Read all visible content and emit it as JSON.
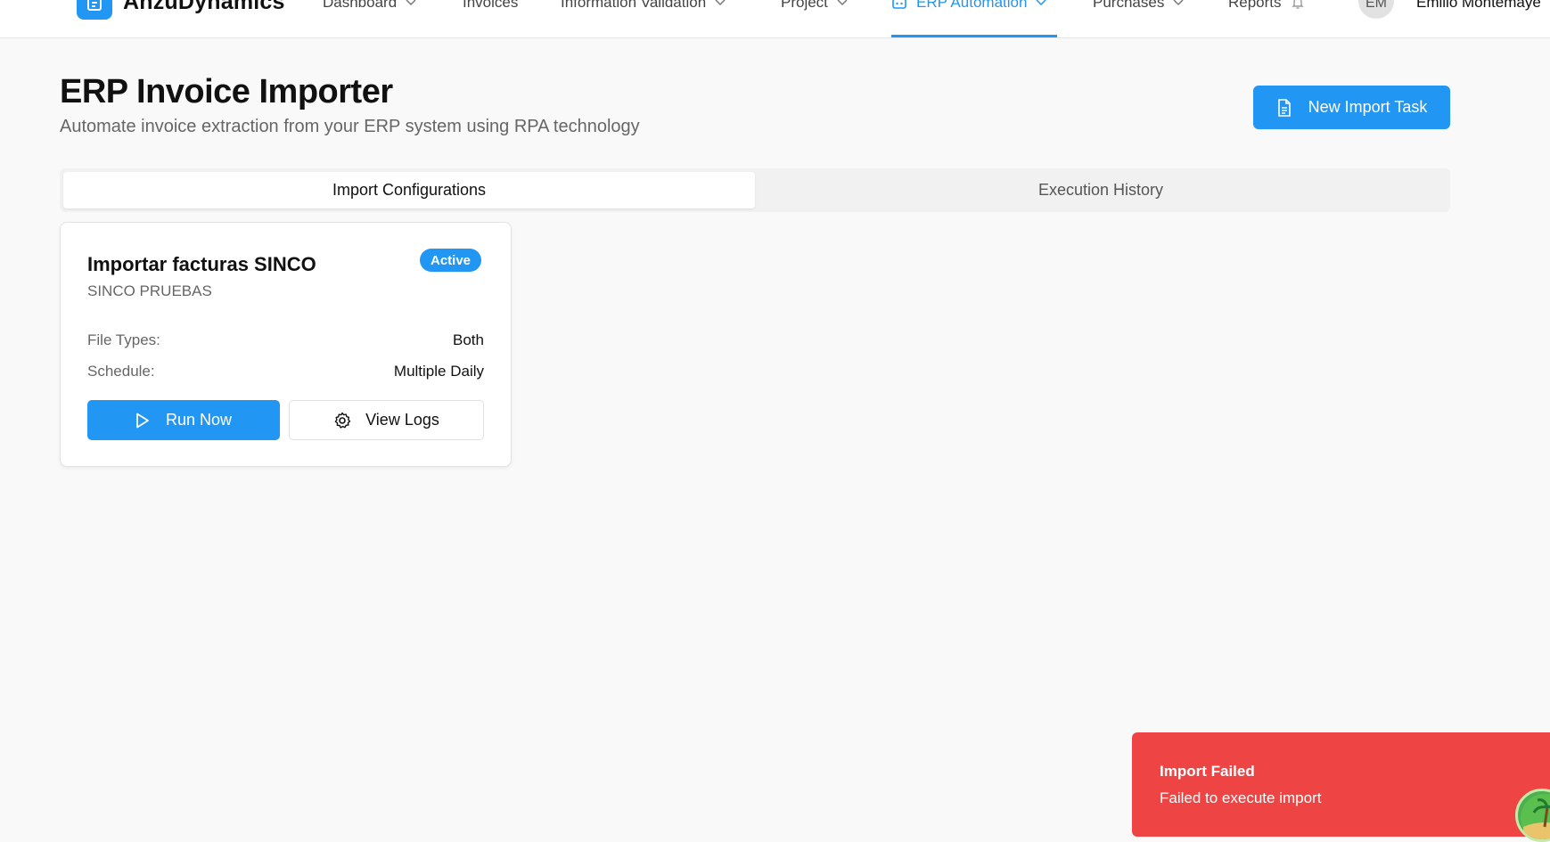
{
  "header": {
    "brand": "AnzuDynamics",
    "nav": [
      {
        "label": "Dashboard",
        "has_dropdown": true
      },
      {
        "label": "Invoices",
        "has_dropdown": false
      },
      {
        "label": "Information Validation",
        "has_dropdown": true
      },
      {
        "label": "Project",
        "has_dropdown": true
      },
      {
        "label": "ERP Automation",
        "has_dropdown": true,
        "active": true
      },
      {
        "label": "Purchases",
        "has_dropdown": true
      },
      {
        "label": "Reports",
        "has_dropdown": false
      }
    ],
    "user_initials": "EM",
    "user_name": "Emilio Montemaye"
  },
  "page": {
    "title": "ERP Invoice Importer",
    "subtitle": "Automate invoice extraction from your ERP system using RPA technology",
    "new_task_label": "New Import Task"
  },
  "tabs": [
    {
      "label": "Import Configurations",
      "active": true
    },
    {
      "label": "Execution History",
      "active": false
    }
  ],
  "config_card": {
    "title": "Importar facturas SINCO",
    "subtitle": "SINCO PRUEBAS",
    "status": "Active",
    "rows": [
      {
        "label": "File Types:",
        "value": "Both"
      },
      {
        "label": "Schedule:",
        "value": "Multiple Daily"
      }
    ],
    "run_label": "Run Now",
    "logs_label": "View Logs"
  },
  "toast": {
    "title": "Import Failed",
    "message": "Failed to execute import"
  },
  "colors": {
    "accent": "#2196f3",
    "error": "#ef4444",
    "background": "#f9f9f9"
  },
  "icons": {
    "brand": "document-icon",
    "new_task": "file-text-icon",
    "run": "play-icon",
    "logs": "settings-gear-icon",
    "reports": "bell-icon",
    "erp": "robot-icon"
  }
}
